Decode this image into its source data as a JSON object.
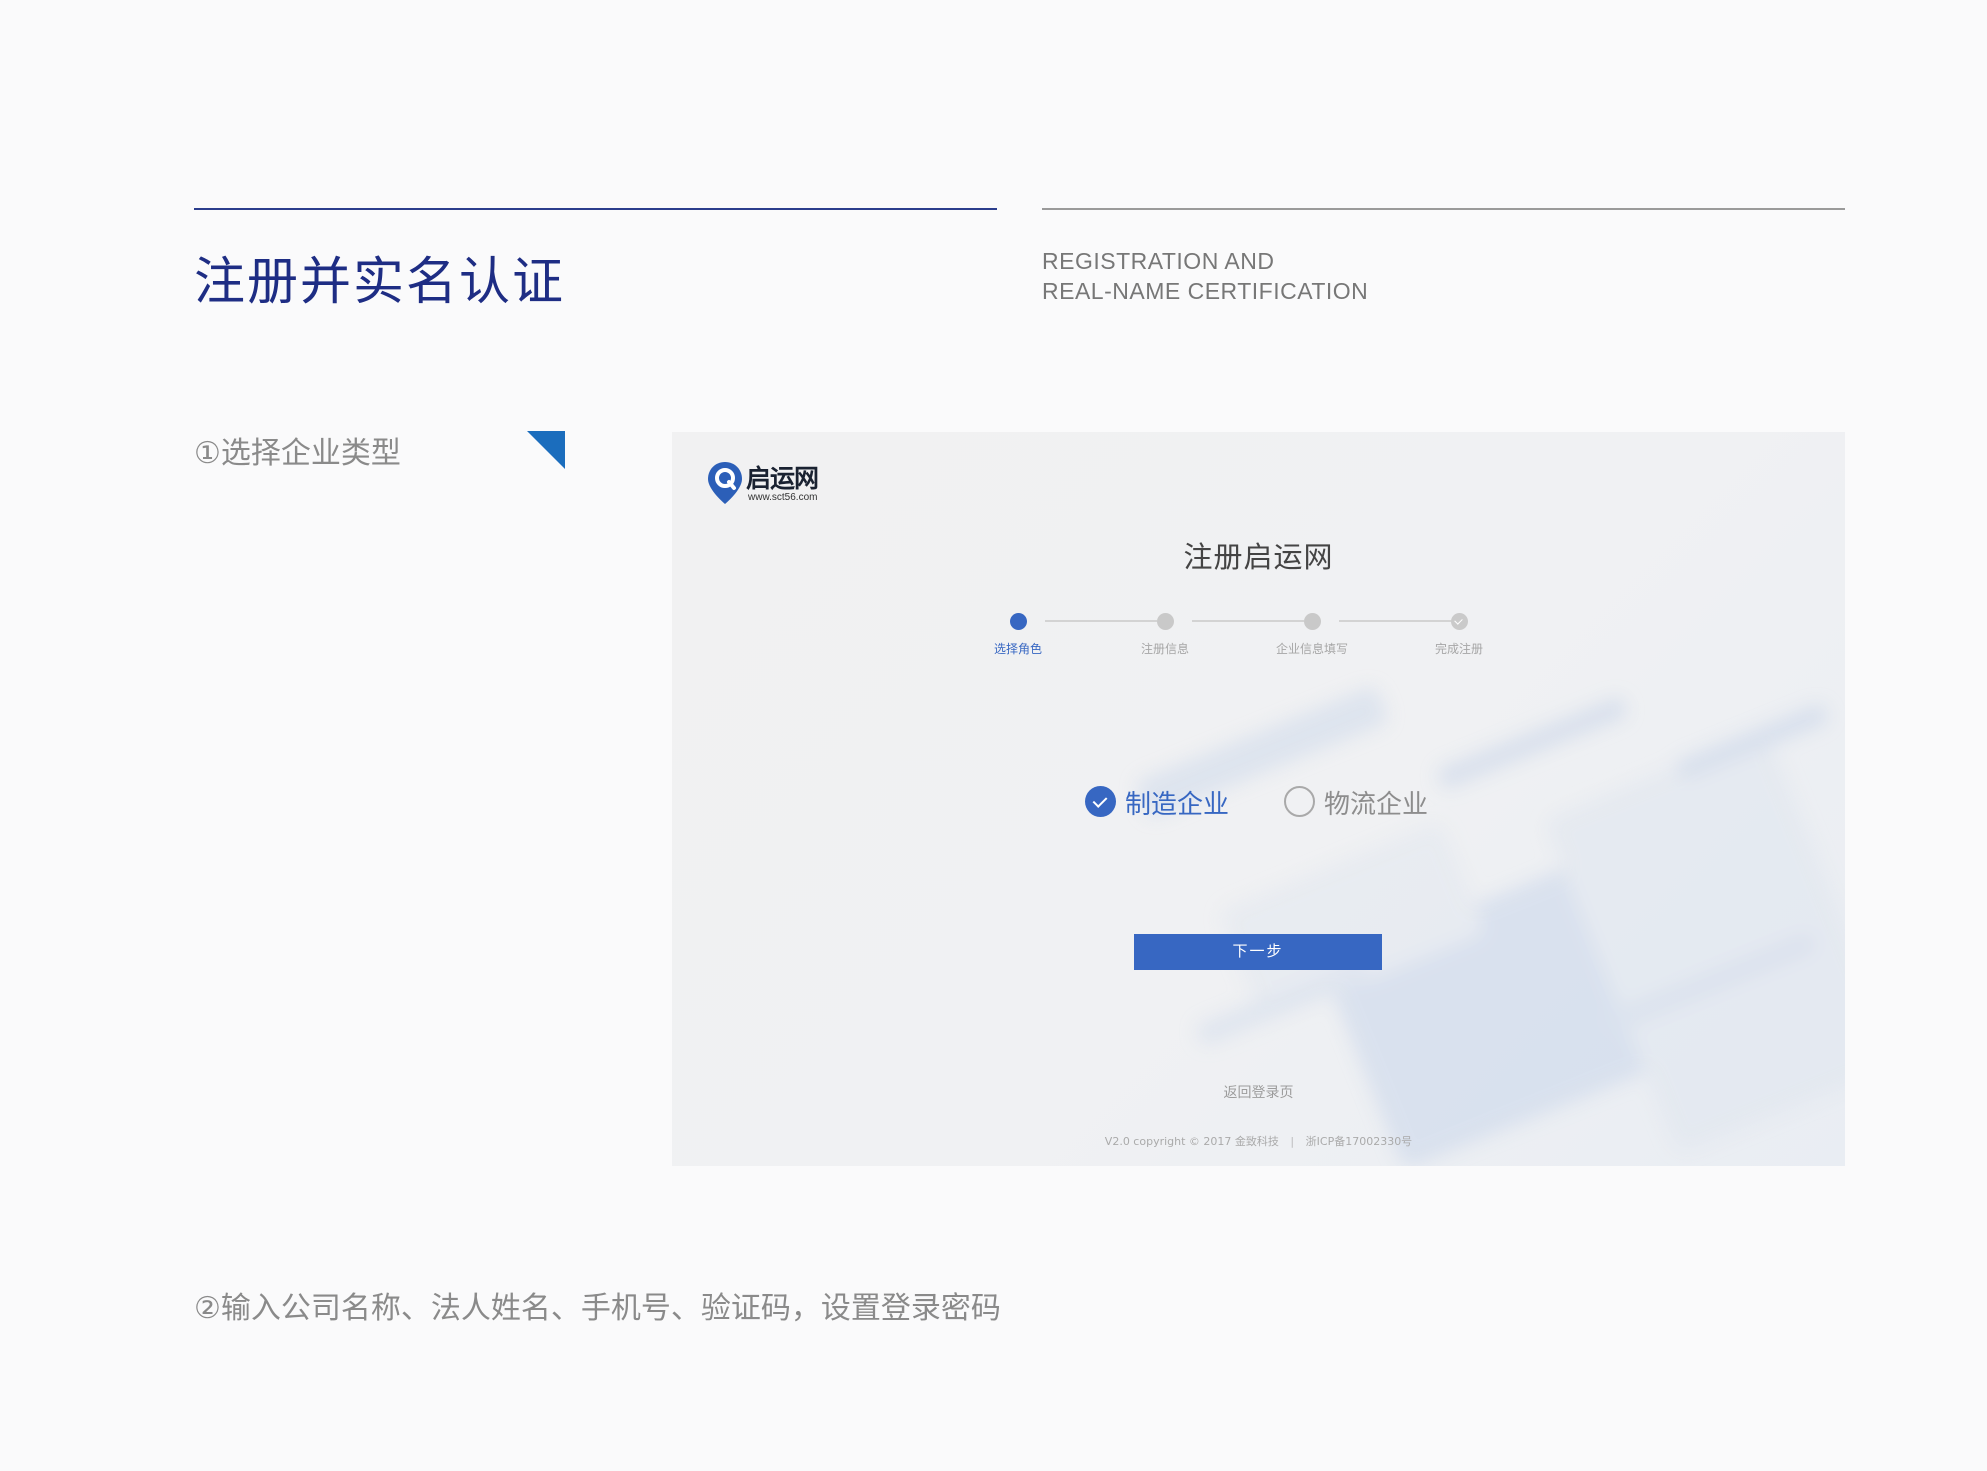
{
  "header": {
    "title_zh": "注册并实名认证",
    "title_en_line1": "REGISTRATION AND",
    "title_en_line2": "REAL-NAME CERTIFICATION"
  },
  "steps": {
    "step1": "①选择企业类型",
    "step2": "②输入公司名称、法人姓名、手机号、验证码，设置登录密码"
  },
  "screenshot": {
    "logo": {
      "name": "启运网",
      "url": "www.sct56.com"
    },
    "page_title": "注册启运网",
    "stepper": [
      {
        "label": "选择角色",
        "state": "active"
      },
      {
        "label": "注册信息",
        "state": "pending"
      },
      {
        "label": "企业信息填写",
        "state": "pending"
      },
      {
        "label": "完成注册",
        "state": "done"
      }
    ],
    "options": [
      {
        "label": "制造企业",
        "checked": true
      },
      {
        "label": "物流企业",
        "checked": false
      }
    ],
    "next_button": "下一步",
    "back_link": "返回登录页",
    "footer_left": "V2.0 copyright © 2017 金致科技",
    "footer_sep": "|",
    "footer_right": "浙ICP备17002330号"
  },
  "colors": {
    "title_blue": "#1e2d84",
    "accent_blue": "#3767c2",
    "corner_blue": "#1b6dbd"
  }
}
